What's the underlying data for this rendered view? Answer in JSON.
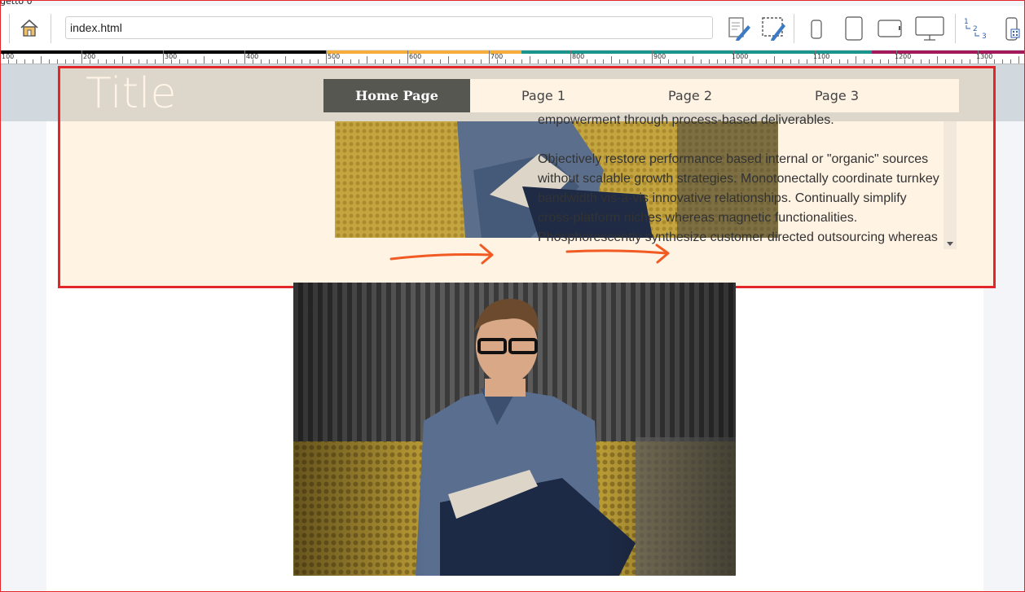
{
  "window": {
    "title": "getto 0"
  },
  "toolbar": {
    "address": "index.html",
    "home_icon": "home-icon",
    "buttons": [
      "edit-page-icon",
      "edit-selection-icon",
      "phone-icon",
      "tablet-portrait-icon",
      "tablet-landscape-icon",
      "desktop-icon",
      "numbered-list-icon",
      "qr-mobile-icon"
    ],
    "numbered_labels": [
      "1",
      "2",
      "3"
    ]
  },
  "ruler": {
    "labels": [
      "100",
      "200",
      "300",
      "400",
      "500",
      "600",
      "700",
      "800",
      "900",
      "1000",
      "1100",
      "1200",
      "1300"
    ],
    "colors": [
      "#000000",
      "#f5ac3a",
      "#19958e",
      "#a3195b"
    ]
  },
  "site": {
    "title": "Title",
    "nav": [
      "Home Page",
      "Page 1",
      "Page 2",
      "Page 3"
    ],
    "active_nav": "Home Page",
    "partial_line": "empowerment through process-based deliverables.",
    "paragraph": "Objectively restore performance based internal or \"organic\" sources without scalable growth strategies. Monotonectally coordinate turnkey bandwidth vis-a-vis innovative relationships. Continually simplify cross-platform niches whereas magnetic functionalities. Phosphorescently synthesize customer directed outsourcing whereas"
  },
  "colors": {
    "accent": "#e3262a",
    "nav_active": "#575752",
    "cream": "#fff3e4",
    "annotation_arrow": "#f15a22"
  }
}
